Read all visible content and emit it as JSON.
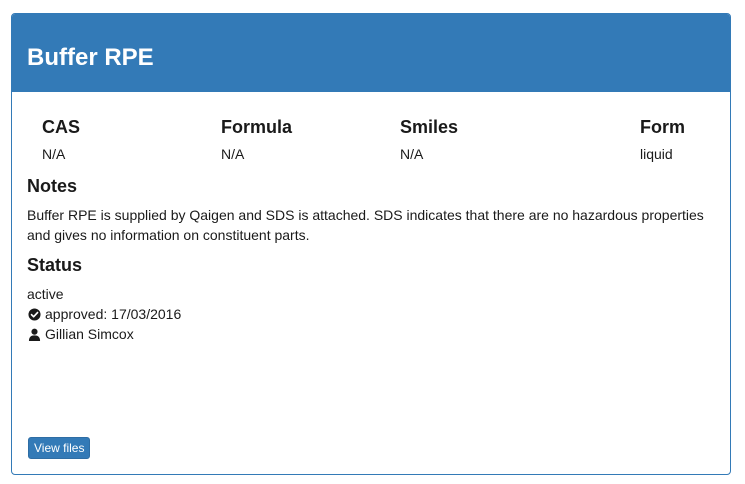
{
  "title": "Buffer RPE",
  "properties": [
    {
      "label": "CAS",
      "value": "N/A"
    },
    {
      "label": "Formula",
      "value": "N/A"
    },
    {
      "label": "Smiles",
      "value": "N/A"
    },
    {
      "label": "Form",
      "value": "liquid"
    }
  ],
  "notes": {
    "heading": "Notes",
    "text": "Buffer RPE is supplied by Qaigen and SDS is attached. SDS indicates that there are no hazardous properties and gives no information on constituent parts."
  },
  "status": {
    "heading": "Status",
    "state": "active",
    "approval_icon": "check-circle-icon",
    "approval": "approved: 17/03/2016",
    "user_icon": "user-icon",
    "user": "Gillian Simcox"
  },
  "view_files_label": "View files",
  "colors": {
    "primary": "#337ab7",
    "border": "#2e6da4"
  }
}
